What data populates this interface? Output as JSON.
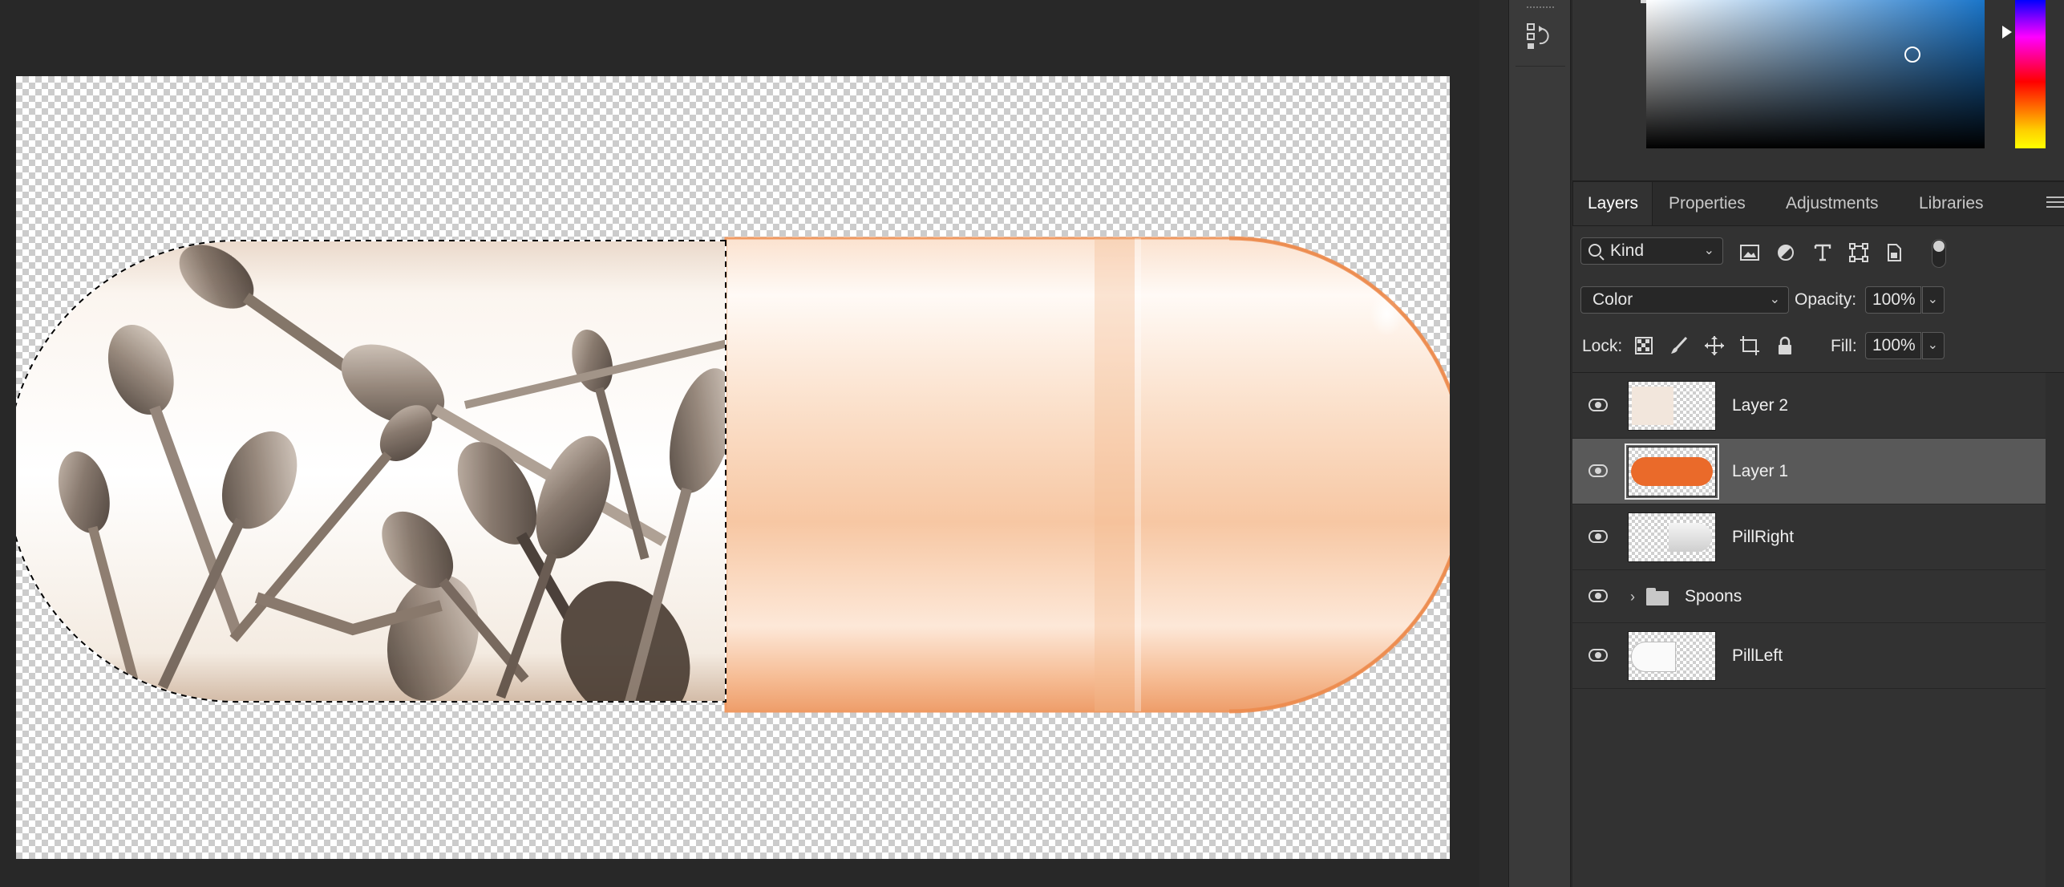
{
  "layers_panel": {
    "tabs": [
      "Layers",
      "Properties",
      "Adjustments",
      "Libraries"
    ],
    "active_tab": "Layers",
    "filter_kind": "Kind",
    "blend_mode": "Color",
    "opacity_label": "Opacity:",
    "opacity_value": "100%",
    "lock_label": "Lock:",
    "fill_label": "Fill:",
    "fill_value": "100%",
    "layers": [
      {
        "name": "Layer 2",
        "visible": true,
        "selected": false
      },
      {
        "name": "Layer 1",
        "visible": true,
        "selected": true
      },
      {
        "name": "PillRight",
        "visible": true,
        "selected": false
      },
      {
        "name": "Spoons",
        "visible": true,
        "selected": false,
        "type": "group",
        "expanded": false
      },
      {
        "name": "PillLeft",
        "visible": true,
        "selected": false
      }
    ]
  },
  "colors": {
    "app_background": "#282828",
    "panel_background": "#323232",
    "selected_layer": "#595959",
    "pill_peach": "#f6c29b",
    "layer1_fill": "#ea6a2a"
  },
  "icons": {
    "filter_icons": [
      "pixel-layer-filter-icon",
      "adjustment-layer-filter-icon",
      "type-layer-filter-icon",
      "shape-layer-filter-icon",
      "smart-object-filter-icon"
    ],
    "lock_icons": [
      "lock-transparent-pixels-icon",
      "lock-image-pixels-icon",
      "lock-position-icon",
      "lock-artboard-icon",
      "lock-all-icon"
    ]
  }
}
